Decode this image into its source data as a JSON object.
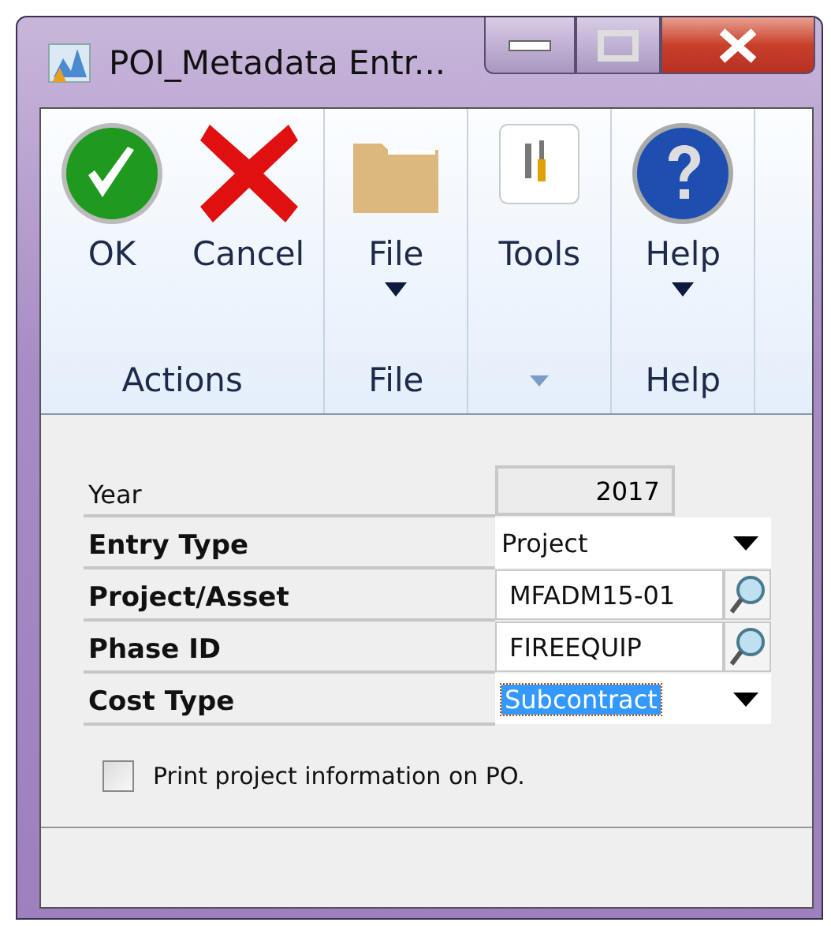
{
  "window": {
    "title": "POI_Metadata Entr..."
  },
  "ribbon": {
    "groups": [
      {
        "label": "Actions",
        "launcher": false,
        "buttons": [
          {
            "label": "OK",
            "kind": "check",
            "menu": false
          },
          {
            "label": "Cancel",
            "kind": "cross",
            "menu": false
          }
        ]
      },
      {
        "label": "File",
        "launcher": false,
        "buttons": [
          {
            "label": "File",
            "kind": "folder",
            "menu": true
          }
        ]
      },
      {
        "launcher": true,
        "buttons": [
          {
            "label": "Tools",
            "kind": "tools",
            "menu": false
          }
        ]
      },
      {
        "label": "Help",
        "launcher": false,
        "buttons": [
          {
            "label": "Help",
            "kind": "help",
            "menu": true
          }
        ]
      }
    ]
  },
  "form": {
    "fields": [
      {
        "label": "Year",
        "kind": "readonly",
        "value": "2017",
        "bold": false
      },
      {
        "label": "Entry Type",
        "kind": "dropdown",
        "value": "Project",
        "bold": true,
        "highlighted": false
      },
      {
        "label": "Project/Asset",
        "kind": "lookup",
        "value": "MFADM15-01",
        "bold": true
      },
      {
        "label": "Phase ID",
        "kind": "lookup",
        "value": "FIREEQUIP",
        "bold": true
      },
      {
        "label": "Cost Type",
        "kind": "dropdown",
        "value": "Subcontract",
        "bold": true,
        "highlighted": true
      }
    ],
    "checkbox": {
      "label": "Print project information on PO.",
      "checked": false
    }
  }
}
